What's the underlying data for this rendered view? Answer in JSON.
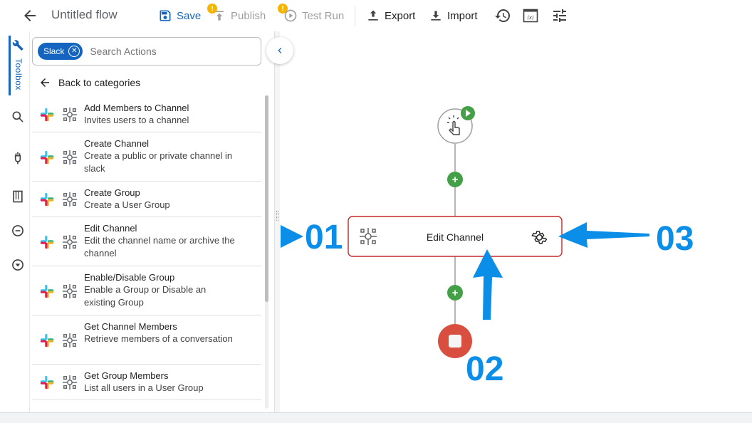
{
  "header": {
    "title": "Untitled flow",
    "save_label": "Save",
    "publish_label": "Publish",
    "testrun_label": "Test Run",
    "export_label": "Export",
    "import_label": "Import",
    "warning_mark": "!"
  },
  "rail": {
    "toolbox_label": "Toolbox"
  },
  "panel": {
    "filter_chip": "Slack",
    "search_placeholder": "Search Actions",
    "back_label": "Back to categories",
    "actions": [
      {
        "title": "Add Members to Channel",
        "description": "Invites users to a channel"
      },
      {
        "title": "Create Channel",
        "description": "Create a public or private channel in slack"
      },
      {
        "title": "Create Group",
        "description": "Create a User Group"
      },
      {
        "title": "Edit Channel",
        "description": "Edit the channel name or archive the channel"
      },
      {
        "title": "Enable/Disable Group",
        "description": "Enable a Group or Disable an existing Group"
      },
      {
        "title": "Get Channel Members",
        "description": "Retrieve members of a conversation"
      },
      {
        "title": "Get Group Members",
        "description": "List all users in a User Group"
      }
    ]
  },
  "canvas": {
    "node_label": "Edit Channel",
    "add_symbol": "+"
  },
  "annotations": {
    "label_01": "01",
    "label_02": "02",
    "label_03": "03",
    "color": "#0a8ee8"
  },
  "colors": {
    "primary": "#1565c0",
    "node_border": "#c62828",
    "add_button": "#43a047",
    "stop_button": "#d94f3f",
    "start_badge": "#43a047"
  }
}
